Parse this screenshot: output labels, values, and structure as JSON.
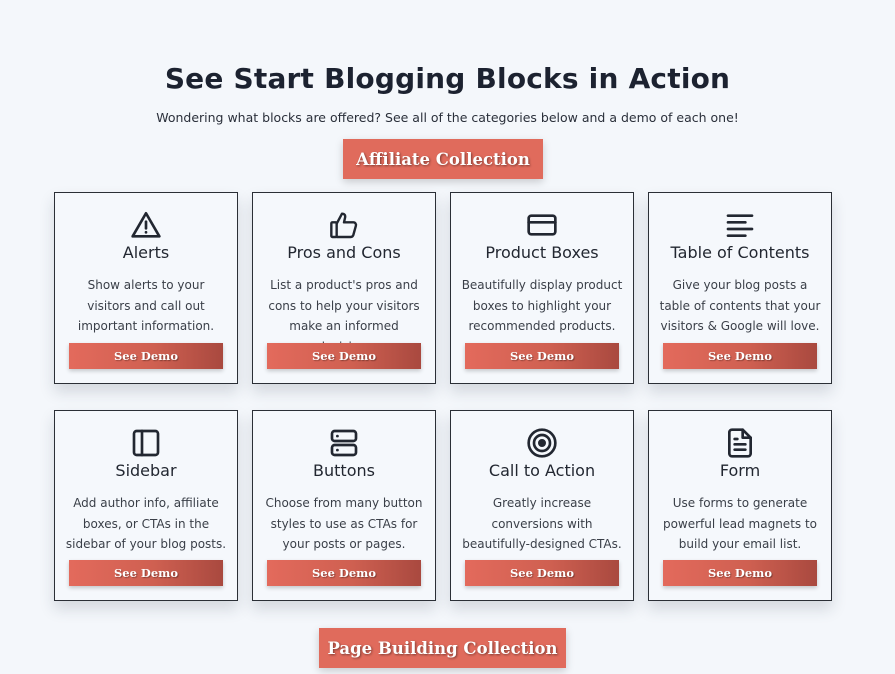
{
  "header": {
    "title": "See Start Blogging Blocks in Action",
    "subtitle": "Wondering what blocks are offered? See all of the categories below and a demo of each one!"
  },
  "collections": {
    "affiliate_label": "Affiliate Collection",
    "page_building_label": "Page Building Collection"
  },
  "colors": {
    "accent": "#e06b5c",
    "accent_dark": "#a9493f",
    "text": "#222731",
    "background": "#f4f7fb"
  },
  "blocks": [
    {
      "icon": "alert-triangle-icon",
      "title": "Alerts",
      "description": "Show alerts to your visitors and call out important information.",
      "button": "See Demo"
    },
    {
      "icon": "thumbs-up-icon",
      "title": "Pros and Cons",
      "description": "List a product's pros and cons to help your visitors make an informed decision.",
      "button": "See Demo"
    },
    {
      "icon": "credit-card-icon",
      "title": "Product Boxes",
      "description": "Beautifully display product boxes to highlight your recommended products.",
      "button": "See Demo"
    },
    {
      "icon": "list-lines-icon",
      "title": "Table of Contents",
      "description": "Give your blog posts a table of contents that your visitors & Google will love.",
      "button": "See Demo"
    },
    {
      "icon": "sidebar-layout-icon",
      "title": "Sidebar",
      "description": "Add author info, affiliate boxes, or CTAs in the sidebar of your blog posts.",
      "button": "See Demo"
    },
    {
      "icon": "server-buttons-icon",
      "title": "Buttons",
      "description": "Choose from many button styles to use as CTAs for your posts or pages.",
      "button": "See Demo"
    },
    {
      "icon": "target-icon",
      "title": "Call to Action",
      "description": "Greatly increase conversions with beautifully-designed CTAs.",
      "button": "See Demo"
    },
    {
      "icon": "document-icon",
      "title": "Form",
      "description": "Use forms to generate powerful lead magnets to build your email list.",
      "button": "See Demo"
    }
  ]
}
